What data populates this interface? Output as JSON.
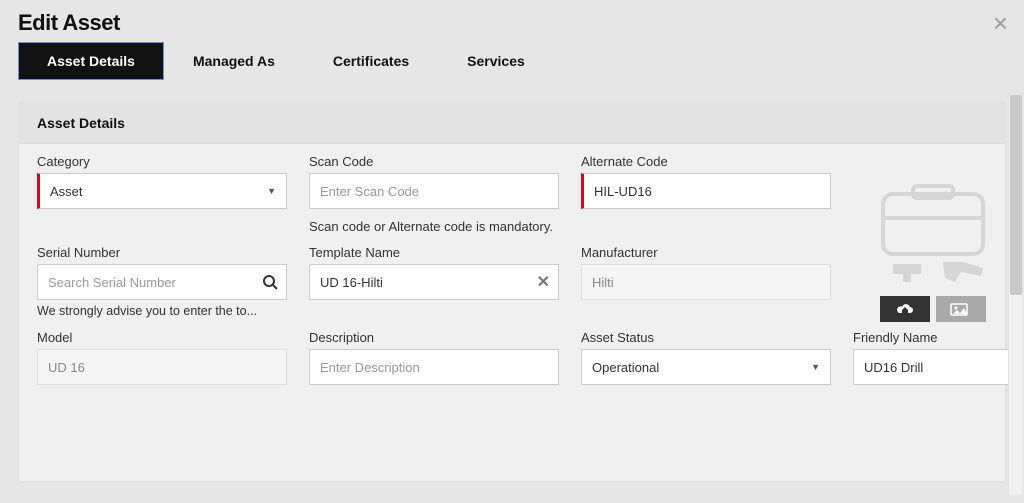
{
  "modal": {
    "title": "Edit Asset",
    "close_label": "×"
  },
  "tabs": [
    {
      "label": "Asset Details",
      "active": true
    },
    {
      "label": "Managed As",
      "active": false
    },
    {
      "label": "Certificates",
      "active": false
    },
    {
      "label": "Services",
      "active": false
    }
  ],
  "section": {
    "title": "Asset Details"
  },
  "fields": {
    "category": {
      "label": "Category",
      "value": "Asset",
      "required": true
    },
    "scan_code": {
      "label": "Scan Code",
      "placeholder": "Enter Scan Code",
      "value": ""
    },
    "alternate_code": {
      "label": "Alternate Code",
      "value": "HIL-UD16",
      "required": true
    },
    "scan_hint": "Scan code or Alternate code is mandatory.",
    "serial_number": {
      "label": "Serial Number",
      "placeholder": "Search Serial Number",
      "value": "",
      "helper": "We strongly advise you to enter the to..."
    },
    "template_name": {
      "label": "Template Name",
      "value": "UD 16-Hilti"
    },
    "manufacturer": {
      "label": "Manufacturer",
      "value": "Hilti",
      "disabled": true
    },
    "model": {
      "label": "Model",
      "value": "UD 16",
      "disabled": true
    },
    "description": {
      "label": "Description",
      "placeholder": "Enter Description",
      "value": ""
    },
    "asset_status": {
      "label": "Asset Status",
      "value": "Operational"
    },
    "friendly_name": {
      "label": "Friendly Name",
      "value": "UD16 Drill"
    }
  },
  "image_actions": {
    "upload_icon": "upload-cloud-icon",
    "delete_icon": "image-delete-icon"
  }
}
